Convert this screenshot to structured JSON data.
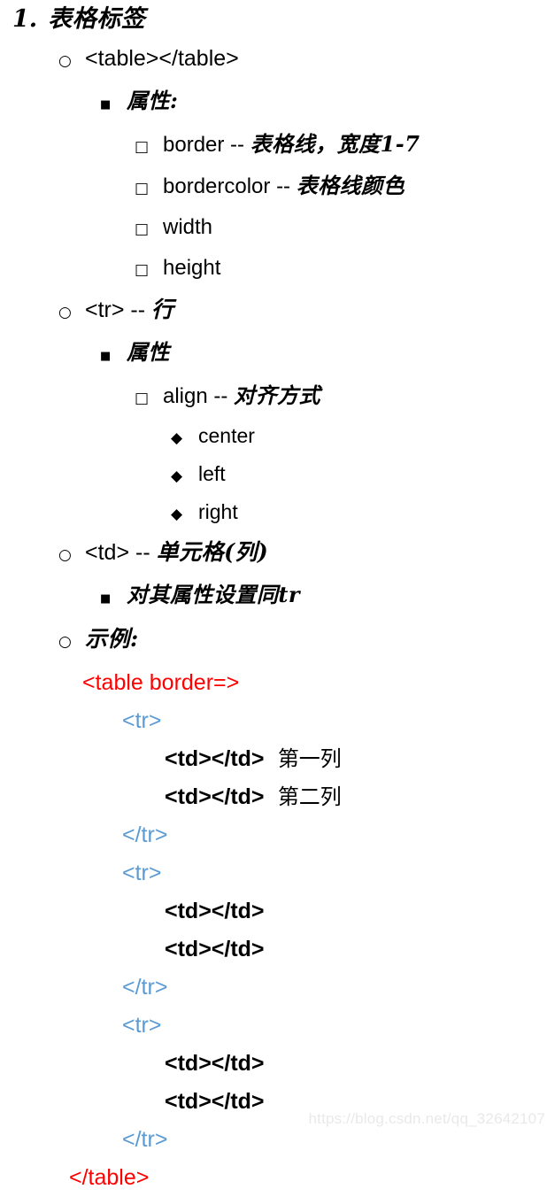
{
  "page": {
    "background": "#ffffff",
    "watermark": "https://blog.csdn.net/qq_32642107"
  },
  "colors": {
    "text": "#000000",
    "code_tag_red": "#ff0000",
    "code_tag_blue": "#5b9bd5",
    "watermark": "#e9e9e9"
  },
  "bullets": {
    "level1": "1.",
    "level2": "○",
    "level3": "■",
    "level4": "□",
    "level5": "◆"
  },
  "outline": {
    "heading": {
      "number": "1.",
      "text": "表格标签"
    },
    "items": [
      {
        "level": 2,
        "bullet": "○",
        "text": "<table></table>",
        "script": "latin"
      },
      {
        "level": 3,
        "bullet": "■",
        "text": "属性:",
        "script": "cn"
      },
      {
        "level": 4,
        "bullet": "□",
        "text": "border -- 表格线，宽度1-7",
        "script": "mixed"
      },
      {
        "level": 4,
        "bullet": "□",
        "text": "bordercolor -- 表格线颜色",
        "script": "mixed"
      },
      {
        "level": 4,
        "bullet": "□",
        "text": "width",
        "script": "latin"
      },
      {
        "level": 4,
        "bullet": "□",
        "text": "height",
        "script": "latin"
      },
      {
        "level": 2,
        "bullet": "○",
        "text": "<tr> -- 行",
        "script": "mixed"
      },
      {
        "level": 3,
        "bullet": "■",
        "text": "属性",
        "script": "cn"
      },
      {
        "level": 4,
        "bullet": "□",
        "text": "align -- 对齐方式",
        "script": "mixed"
      },
      {
        "level": 5,
        "bullet": "◆",
        "text": "center",
        "script": "latin"
      },
      {
        "level": 5,
        "bullet": "◆",
        "text": "left",
        "script": "latin"
      },
      {
        "level": 5,
        "bullet": "◆",
        "text": "right",
        "script": "latin"
      },
      {
        "level": 2,
        "bullet": "○",
        "text": "<td> -- 单元格(列)",
        "script": "mixed"
      },
      {
        "level": 3,
        "bullet": "■",
        "text": "对其属性设置同tr",
        "script": "mixed"
      },
      {
        "level": 2,
        "bullet": "○",
        "text": "示例:",
        "script": "cn"
      }
    ],
    "split": {
      "border_latin": "border -- ",
      "border_cn": "表格线，宽度1-7",
      "bordercolor_latin": "bordercolor -- ",
      "bordercolor_cn": "表格线颜色",
      "tr_latin": "<tr> -- ",
      "tr_cn": "行",
      "align_latin": "align -- ",
      "align_cn": "对齐方式",
      "td_latin": "<td> -- ",
      "td_cn": "单元格(列)",
      "settr_cn": "对其属性设置同tr"
    }
  },
  "code_example": {
    "lines": [
      {
        "kind": "table-open",
        "text": "<table border=>",
        "color": "#ff0000"
      },
      {
        "kind": "tr-open",
        "text": "<tr>",
        "color": "#5b9bd5"
      },
      {
        "kind": "td",
        "text": "<td></td>",
        "annotation": "第一列",
        "color": "#000000"
      },
      {
        "kind": "td",
        "text": "<td></td>",
        "annotation": "第二列",
        "color": "#000000"
      },
      {
        "kind": "tr-close",
        "text": "</tr>",
        "color": "#5b9bd5"
      },
      {
        "kind": "tr-open",
        "text": "<tr>",
        "color": "#5b9bd5"
      },
      {
        "kind": "td",
        "text": "<td></td>",
        "annotation": "",
        "color": "#000000"
      },
      {
        "kind": "td",
        "text": "<td></td>",
        "annotation": "",
        "color": "#000000"
      },
      {
        "kind": "tr-close",
        "text": "</tr>",
        "color": "#5b9bd5"
      },
      {
        "kind": "tr-open",
        "text": "<tr>",
        "color": "#5b9bd5"
      },
      {
        "kind": "td",
        "text": "<td></td>",
        "annotation": "",
        "color": "#000000"
      },
      {
        "kind": "td",
        "text": "<td></td>",
        "annotation": "",
        "color": "#000000"
      },
      {
        "kind": "tr-close",
        "text": "</tr>",
        "color": "#5b9bd5"
      },
      {
        "kind": "table-close",
        "text": "</table>",
        "color": "#ff0000"
      }
    ]
  }
}
